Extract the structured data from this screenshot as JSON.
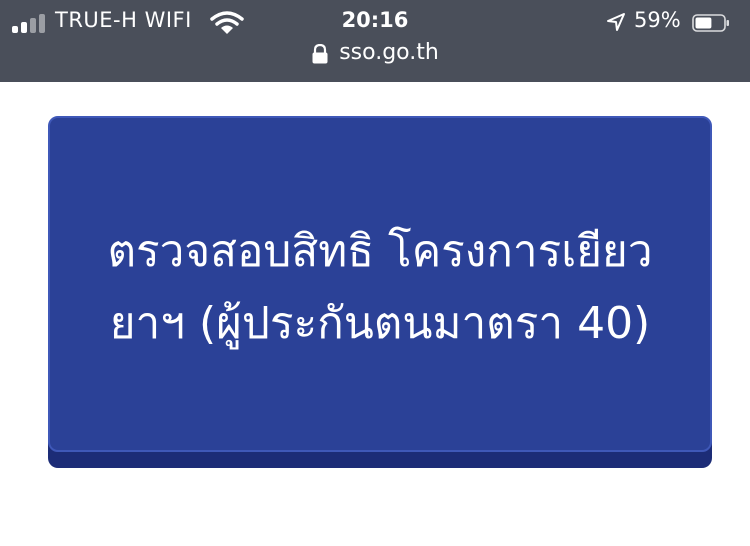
{
  "status_bar": {
    "carrier": "TRUE-H WIFI",
    "time": "20:16",
    "battery_percent": "59%",
    "signal_icon": "cellular-signal-icon",
    "wifi_icon": "wifi-icon",
    "location_icon": "location-arrow-icon",
    "battery_icon": "battery-icon",
    "battery_level": 0.59
  },
  "browser": {
    "url": "sso.go.th",
    "lock_icon": "lock-icon"
  },
  "main": {
    "button_text": "ตรวจสอบสิทธิ โครงการเยียวยาฯ (ผู้ประกันตนมาตรา 40)"
  },
  "colors": {
    "status_bg": "#4a4f5a",
    "button_bg": "#2b4197",
    "button_shadow": "#1c2c77"
  }
}
